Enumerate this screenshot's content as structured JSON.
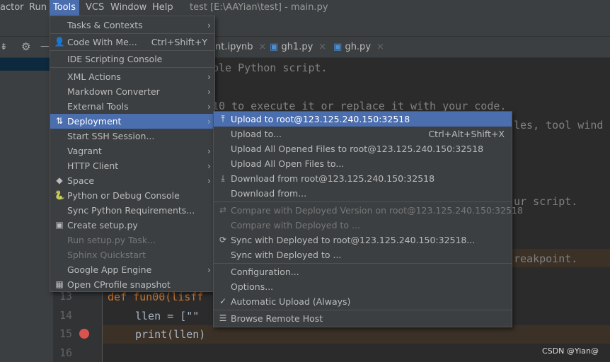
{
  "menubar": {
    "items": [
      "actor",
      "Run",
      "Tools",
      "VCS",
      "Window",
      "Help"
    ],
    "active": "Tools"
  },
  "window_title": "test [E:\\AAYian\\test] - main.py",
  "tabs": [
    {
      "label": "nt.ipynb"
    },
    {
      "label": "gh1.py"
    },
    {
      "label": "gh.py"
    }
  ],
  "tools_menu": [
    {
      "label": "Tasks & Contexts",
      "submenu": true
    },
    {
      "label": "Code With Me...",
      "shortcut": "Ctrl+Shift+Y",
      "icon": "people-icon"
    },
    {
      "label": "IDE Scripting Console"
    },
    {
      "label": "XML Actions",
      "submenu": true
    },
    {
      "label": "Markdown Converter",
      "submenu": true
    },
    {
      "label": "External Tools",
      "submenu": true
    },
    {
      "label": "Deployment",
      "submenu": true,
      "icon": "deploy-icon",
      "selected": true
    },
    {
      "label": "Start SSH Session..."
    },
    {
      "label": "Vagrant",
      "submenu": true
    },
    {
      "label": "HTTP Client",
      "submenu": true
    },
    {
      "label": "Space",
      "submenu": true,
      "icon": "space-icon"
    },
    {
      "label": "Python or Debug Console",
      "icon": "python-icon"
    },
    {
      "label": "Sync Python Requirements..."
    },
    {
      "label": "Create setup.py",
      "icon": "python-file-icon"
    },
    {
      "label": "Run setup.py Task...",
      "disabled": true
    },
    {
      "label": "Sphinx Quickstart",
      "disabled": true
    },
    {
      "label": "Google App Engine",
      "submenu": true
    },
    {
      "label": "Open CProfile snapshot",
      "icon": "profile-icon"
    }
  ],
  "deployment_menu": [
    {
      "label": "Upload to root@123.125.240.150:32518",
      "icon": "upload-icon",
      "selected": true
    },
    {
      "label": "Upload to...",
      "shortcut": "Ctrl+Alt+Shift+X"
    },
    {
      "label": "Upload All Opened Files to root@123.125.240.150:32518"
    },
    {
      "label": "Upload All Open Files to..."
    },
    {
      "label": "Download from root@123.125.240.150:32518",
      "icon": "download-icon"
    },
    {
      "label": "Download from..."
    },
    {
      "label": "Compare with Deployed Version on root@123.125.240.150:32518",
      "disabled": true,
      "icon": "compare-icon"
    },
    {
      "label": "Compare with Deployed to ...",
      "disabled": true
    },
    {
      "label": "Sync with Deployed to root@123.125.240.150:32518...",
      "icon": "sync-icon"
    },
    {
      "label": "Sync with Deployed to ..."
    },
    {
      "label": "Configuration..."
    },
    {
      "label": "Options..."
    },
    {
      "label": "Automatic Upload (Always)",
      "icon": "check-icon"
    },
    {
      "label": "Browse Remote Host",
      "icon": "server-icon"
    }
  ],
  "editor": {
    "fragments": [
      "ple Python script.",
      "10 to execute it or replace it with your code.",
      "les, tool wind",
      "ur script.",
      "reakpoint."
    ],
    "lines": [
      {
        "num": "13",
        "text": "def fun00(lisff"
      },
      {
        "num": "14",
        "text": "llen = [\"\""
      },
      {
        "num": "15",
        "text": "print(llen)"
      },
      {
        "num": "16",
        "text": ""
      }
    ]
  },
  "watermark": "CSDN @Yian@"
}
